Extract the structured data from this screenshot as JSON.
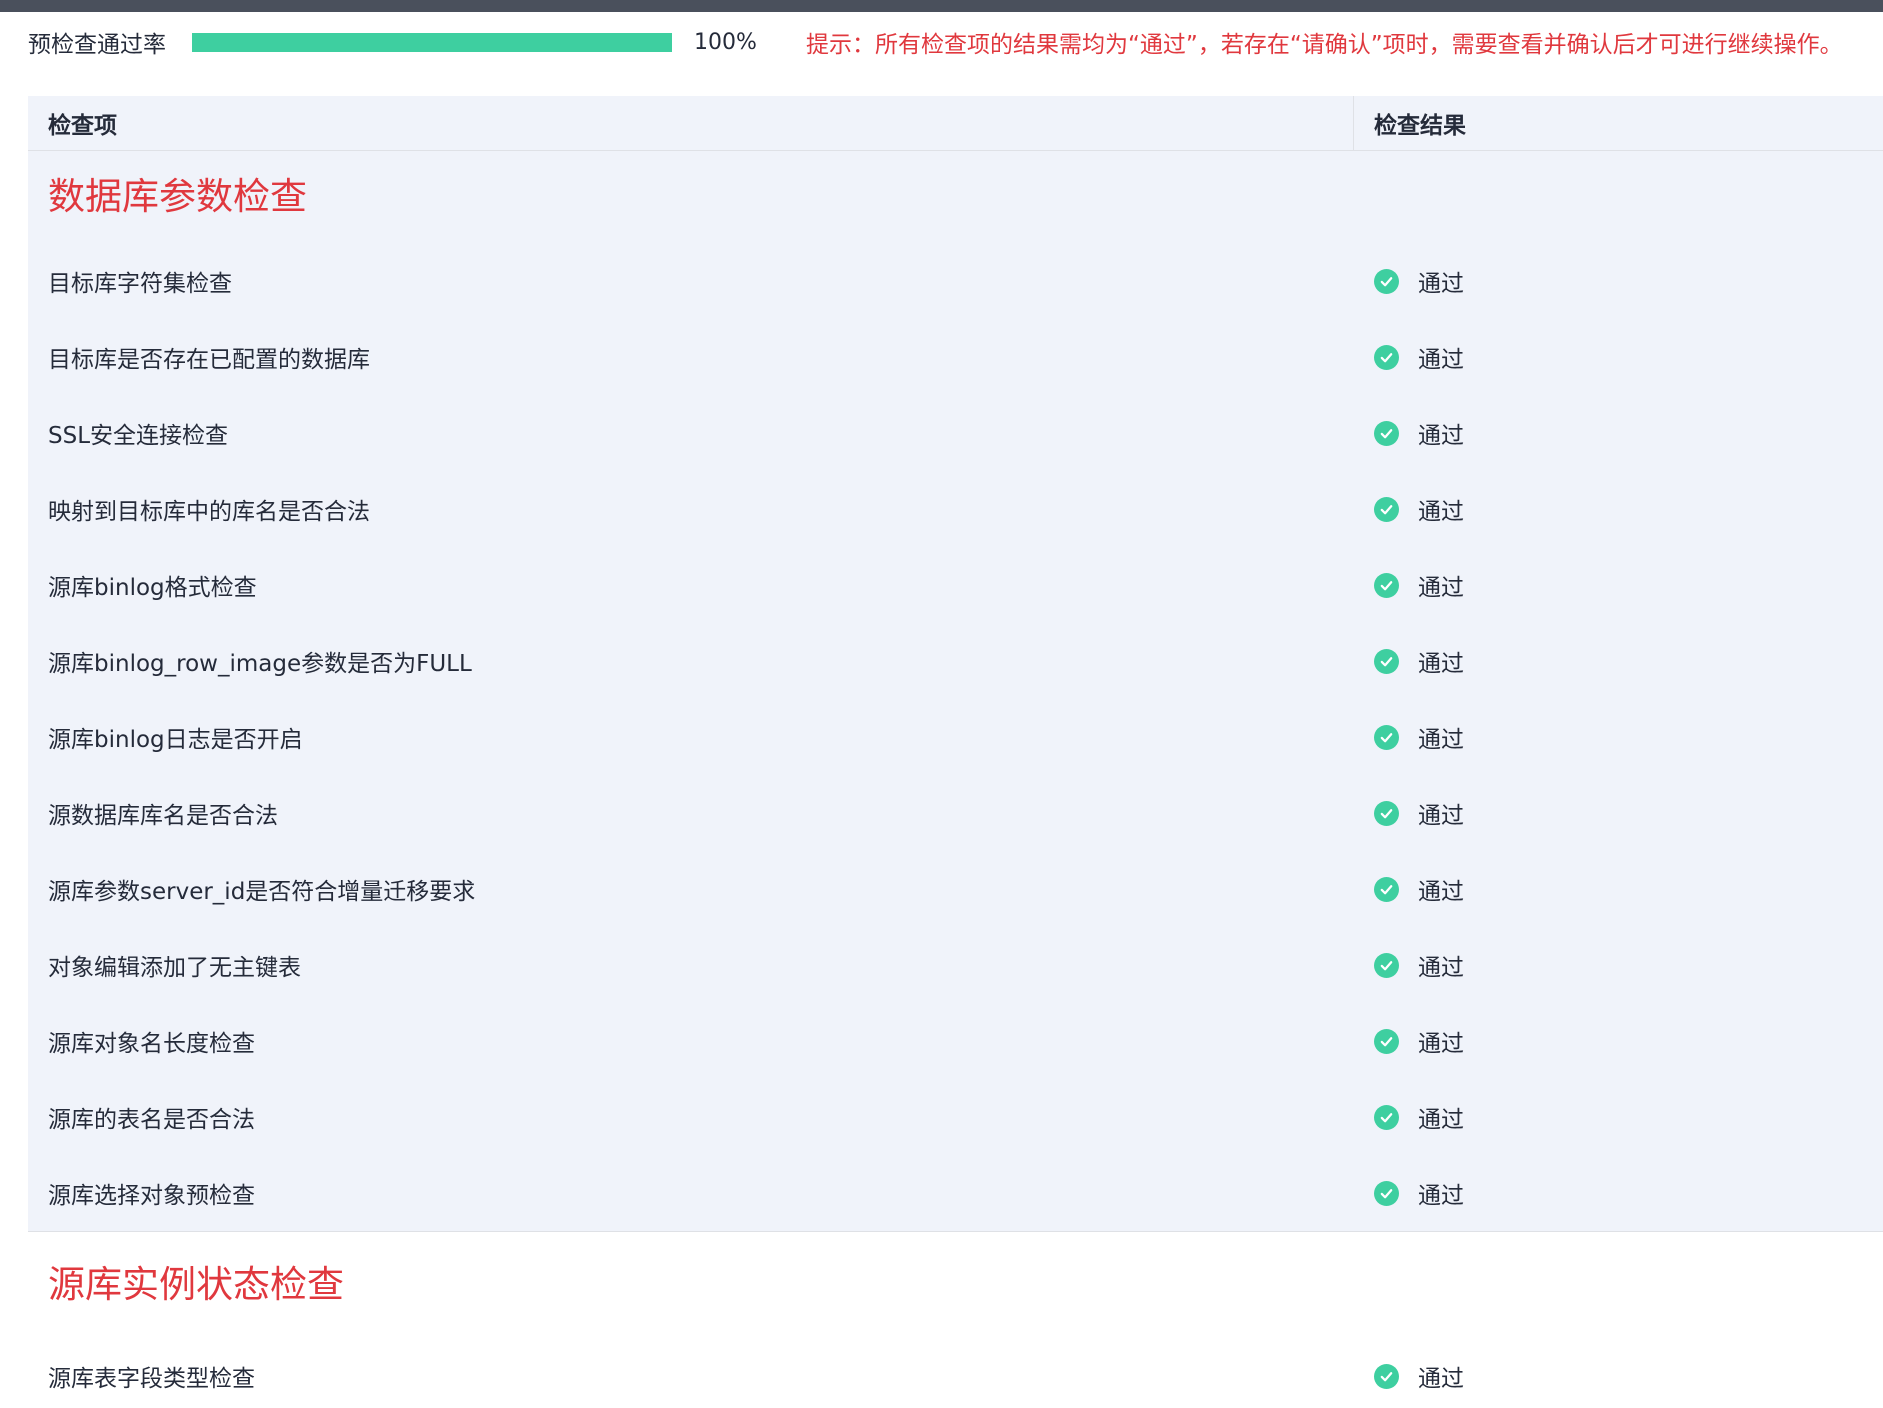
{
  "progress": {
    "label": "预检查通过率",
    "percent": 100,
    "value_text": "100%",
    "fill_color": "#3ecfa0"
  },
  "hint": "提示：所有检查项的结果需均为“通过”，若存在“请确认”项时，需要查看并确认后才可进行继续操作。",
  "table": {
    "col_item": "检查项",
    "col_result": "检查结果"
  },
  "sections": [
    {
      "title": "数据库参数检查",
      "rows": [
        {
          "item": "目标库字符集检查",
          "result": "通过",
          "icon": "check-circle-icon"
        },
        {
          "item": "目标库是否存在已配置的数据库",
          "result": "通过",
          "icon": "check-circle-icon"
        },
        {
          "item": "SSL安全连接检查",
          "result": "通过",
          "icon": "check-circle-icon"
        },
        {
          "item": "映射到目标库中的库名是否合法",
          "result": "通过",
          "icon": "check-circle-icon"
        },
        {
          "item": "源库binlog格式检查",
          "result": "通过",
          "icon": "check-circle-icon"
        },
        {
          "item": "源库binlog_row_image参数是否为FULL",
          "result": "通过",
          "icon": "check-circle-icon"
        },
        {
          "item": "源库binlog日志是否开启",
          "result": "通过",
          "icon": "check-circle-icon"
        },
        {
          "item": "源数据库库名是否合法",
          "result": "通过",
          "icon": "check-circle-icon"
        },
        {
          "item": "源库参数server_id是否符合增量迁移要求",
          "result": "通过",
          "icon": "check-circle-icon"
        },
        {
          "item": "对象编辑添加了无主键表",
          "result": "通过",
          "icon": "check-circle-icon"
        },
        {
          "item": "源库对象名长度检查",
          "result": "通过",
          "icon": "check-circle-icon"
        },
        {
          "item": "源库的表名是否合法",
          "result": "通过",
          "icon": "check-circle-icon"
        },
        {
          "item": "源库选择对象预检查",
          "result": "通过",
          "icon": "check-circle-icon"
        }
      ]
    },
    {
      "title": "源库实例状态检查",
      "rows": [
        {
          "item": "源库表字段类型检查",
          "result": "通过",
          "icon": "check-circle-icon"
        }
      ]
    }
  ],
  "colors": {
    "pass_green": "#3ecfa0",
    "warning_red": "#e0383e",
    "header_bg": "#f0f3fa"
  }
}
